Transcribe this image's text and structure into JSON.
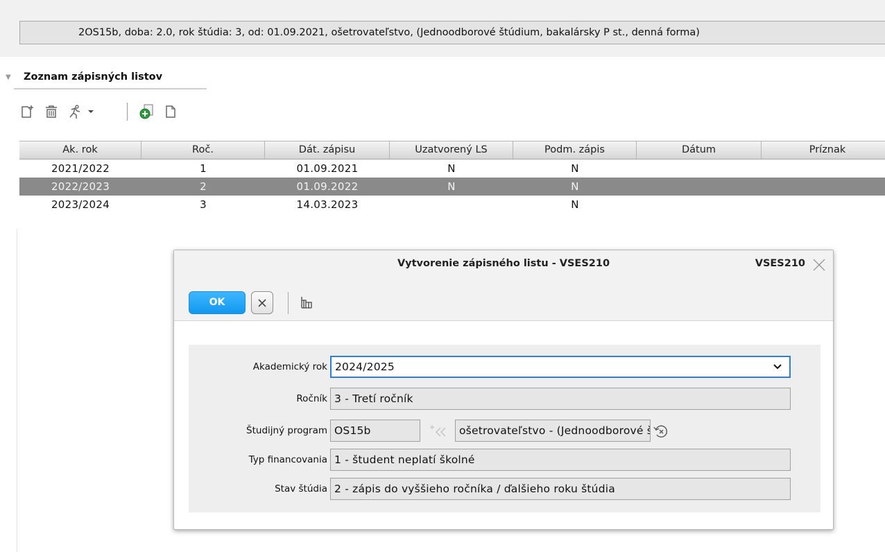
{
  "header": {
    "study_info": "2OS15b, doba: 2.0, rok štúdia: 3, od: 01.09.2021, ošetrovateľstvo, (Jednoodborové štúdium, bakalársky P st., denná forma)"
  },
  "section": {
    "title": "Zoznam zápisných listov"
  },
  "toolbar": {
    "icons": [
      "add-document-icon",
      "trash-icon",
      "runner-icon",
      "chevron-down-icon",
      "add-green-icon",
      "document-icon"
    ]
  },
  "table": {
    "columns": [
      "Ak. rok",
      "Roč.",
      "Dát. zápisu",
      "Uzatvorený LS",
      "Podm. zápis",
      "Dátum",
      "Príznak"
    ],
    "rows": [
      {
        "ak_rok": "2021/2022",
        "roc": "1",
        "dat_zapisu": "01.09.2021",
        "uzatvoreny_ls": "N",
        "podm_zapis": "N",
        "datum": "",
        "priznak": ""
      },
      {
        "ak_rok": "2022/2023",
        "roc": "2",
        "dat_zapisu": "01.09.2022",
        "uzatvoreny_ls": "N",
        "podm_zapis": "N",
        "datum": "",
        "priznak": ""
      },
      {
        "ak_rok": "2023/2024",
        "roc": "3",
        "dat_zapisu": "14.03.2023",
        "uzatvoreny_ls": "",
        "podm_zapis": "N",
        "datum": "",
        "priznak": ""
      }
    ],
    "selected_row": 1
  },
  "dialog": {
    "title": "Vytvorenie zápisného listu - VSES210",
    "code": "VSES210",
    "ok_label": "OK",
    "form": {
      "akademicky_rok_label": "Akademický rok",
      "akademicky_rok_value": "2024/2025",
      "rocnik_label": "Ročník",
      "rocnik_value": "3 - Tretí ročník",
      "studijny_program_label": "Študijný program",
      "studijny_program_code": "OS15b",
      "studijny_program_name": "ošetrovateľstvo - (Jednoodborové štúdium, bakalársky P st., denná forma)",
      "typ_financovania_label": "Typ financovania",
      "typ_financovania_value": "1 - študent neplatí školné",
      "stav_studia_label": "Stav štúdia",
      "stav_studia_value": "2 - zápis do vyššieho ročníka / ďalšieho roku štúdia"
    }
  },
  "colors": {
    "accent": "#1298f0",
    "selected_row": "#8a8a8a",
    "focus_border": "#2f7fd6"
  }
}
